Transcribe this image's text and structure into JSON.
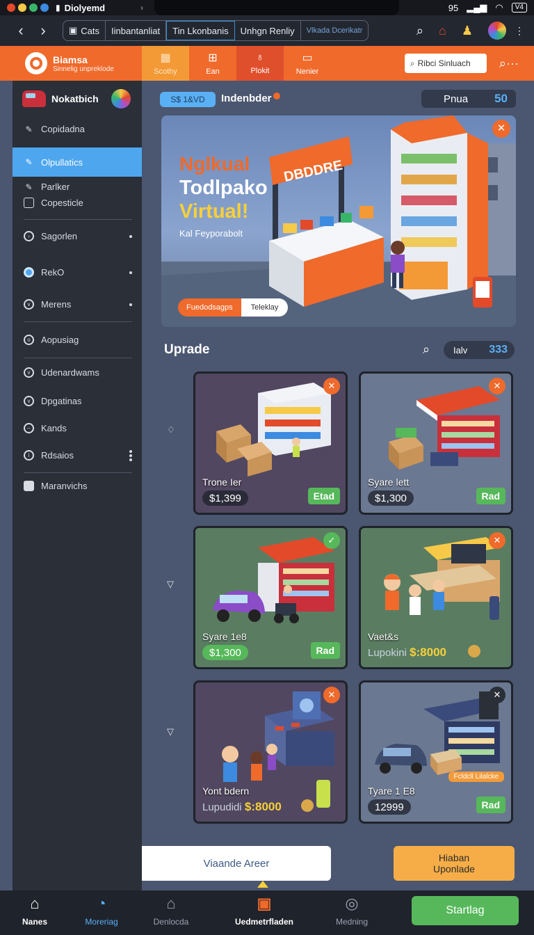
{
  "os": {
    "app_title": "Diolyemd",
    "time": "95",
    "battery": "V4",
    "traffic_colors": [
      "#e24a2a",
      "#f7c948",
      "#39b56a",
      "#3c8be0"
    ]
  },
  "browser": {
    "tabs": [
      "Cats",
      "Iinbantanliat",
      "Tin Lkonbanis",
      "Unhgn Renliy",
      "Vlkada Dcerikatr"
    ]
  },
  "header": {
    "brand_name": "Biamsa",
    "brand_sub": "Sinnelig unpreklode",
    "nav": [
      {
        "label": "Scothy",
        "icon": "grid-icon"
      },
      {
        "label": "Ean",
        "icon": "table-icon"
      },
      {
        "label": "Plokit",
        "icon": "pin-icon"
      },
      {
        "label": "Nenier",
        "icon": "bus-icon"
      }
    ],
    "search_placeholder": "Ribci Sinluach"
  },
  "sidebar": {
    "user_name": "Nokatbich",
    "items": [
      {
        "label": "Copidadna",
        "icon": "edit-icon"
      },
      {
        "label": "Olpullatics",
        "icon": "edit-icon"
      },
      {
        "label": "Parlker",
        "icon": "edit-icon"
      },
      {
        "label": "Copesticle",
        "icon": "square-icon"
      },
      {
        "label": "Sagorlen",
        "icon": "circle-icon"
      },
      {
        "label": "RekO",
        "icon": "radio-icon"
      },
      {
        "label": "Merens",
        "icon": "circle-icon"
      },
      {
        "label": "Aopusiag",
        "icon": "circle-icon"
      },
      {
        "label": "Udenardwams",
        "icon": "circle-icon"
      },
      {
        "label": "Dpgatinas",
        "icon": "circle-icon"
      },
      {
        "label": "Kands",
        "icon": "circle-icon"
      },
      {
        "label": "Rdsaios",
        "icon": "circle-icon"
      },
      {
        "label": "Maranvichs",
        "icon": "square-icon"
      }
    ]
  },
  "main": {
    "pill": "S$ 1&VD",
    "breadcrumb": "Indenbder",
    "score_label": "Pnua",
    "score_value": "50",
    "banner": {
      "line1": "Nglkual",
      "line2": "Todlpako",
      "line3": "Virtual!",
      "subtitle": "Kal Feyporabolt",
      "seg1": "Fuedodsagps",
      "seg2": "Teleklay",
      "sign": "DBDDRE"
    },
    "section_title": "Uprade",
    "filter_label": "Ialv",
    "filter_value": "333",
    "cards": [
      {
        "name": "Trone Ier",
        "price": "$1,399",
        "action": "Etad",
        "close": "✕"
      },
      {
        "name": "Syare lett",
        "price": "$1,300",
        "action": "Rad",
        "close": "✕"
      },
      {
        "name": "Syare 1e8",
        "price": "$1,300",
        "action": "Rad",
        "close": "✓"
      },
      {
        "name": "Vaet&s",
        "price_prefix": "Lupokini",
        "price": "$:8000",
        "close": "✕"
      },
      {
        "name": "Yont bdern",
        "price_prefix": "Lupudidi",
        "price": "$:8000",
        "close": "✕"
      },
      {
        "name": "Tyare 1 E8",
        "price": "12999",
        "action": "Rad",
        "tag": "Fcldcll Lilalcke",
        "close": "✕"
      }
    ]
  },
  "bottom": {
    "white_button": "Viaande Areer",
    "orange_button_line1": "Hiaban",
    "orange_button_line2": "Uponlade",
    "nav": [
      {
        "label": "Nanes",
        "icon": "home-icon"
      },
      {
        "label": "Moreriag",
        "icon": "circle-arrow-icon"
      },
      {
        "label": "Denlocda",
        "icon": "house-outline-icon"
      },
      {
        "label": "Uedmetrfladen",
        "icon": "store-icon"
      },
      {
        "label": "Medning",
        "icon": "globe-icon"
      }
    ],
    "start_button": "Startlag"
  }
}
